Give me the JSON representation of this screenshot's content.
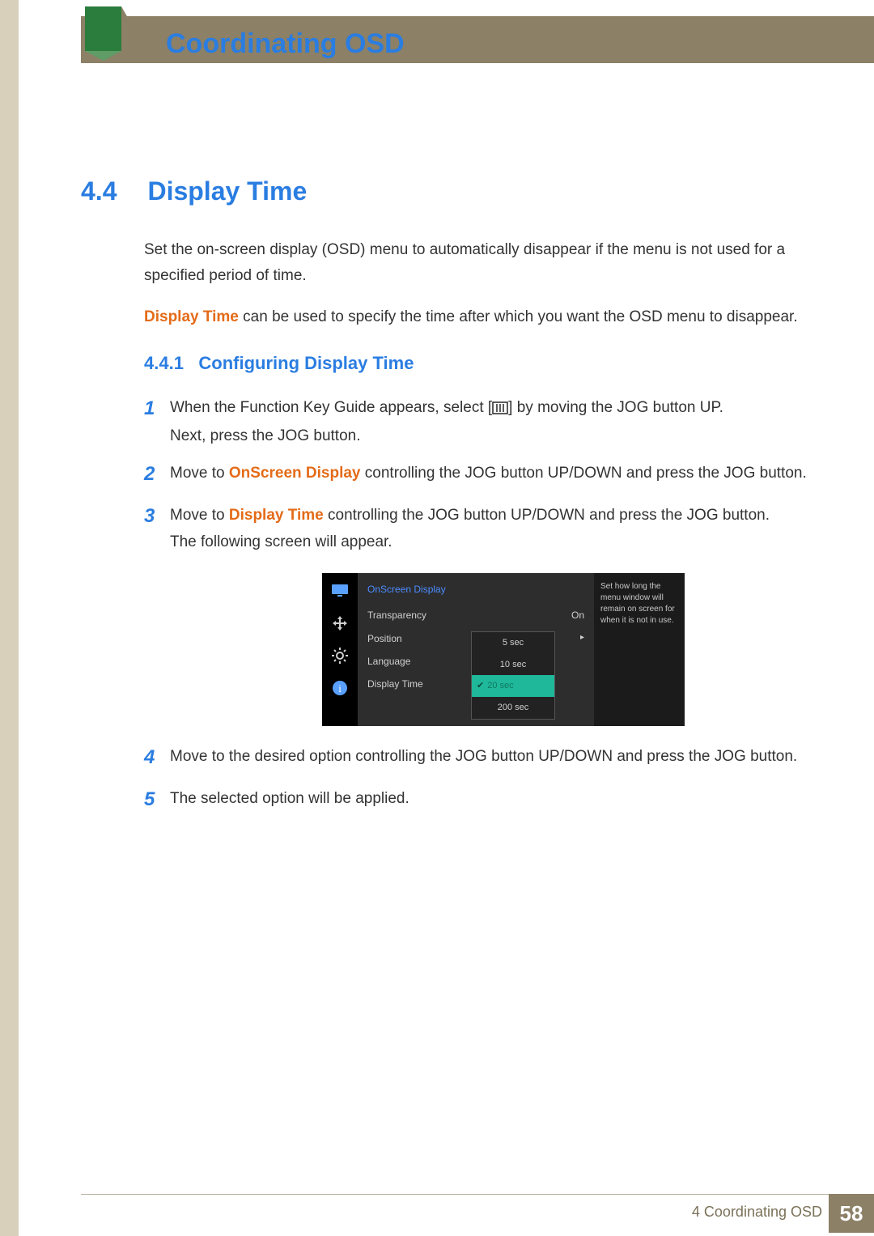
{
  "header": {
    "chapter_number": "4",
    "title": "Coordinating OSD"
  },
  "section": {
    "number": "4.4",
    "title": "Display Time",
    "intro1": "Set the on-screen display (OSD) menu to automatically disappear if the menu is not used for a specified period of time.",
    "intro2_prefix": "Display Time",
    "intro2_rest": " can be used to specify the time after which you want the OSD menu to disappear."
  },
  "subsection": {
    "number": "4.4.1",
    "title": "Configuring Display Time"
  },
  "steps": {
    "s1a": "When the Function Key Guide appears, select [",
    "s1b": "] by moving the JOG button UP.",
    "s1c": "Next, press the JOG button.",
    "s2a": "Move to ",
    "s2_accent": "OnScreen Display",
    "s2b": " controlling the JOG button UP/DOWN and press the JOG button.",
    "s3a": "Move to ",
    "s3_accent": "Display Time",
    "s3b": " controlling the JOG button UP/DOWN and press the JOG button.",
    "s3c": "The following screen will appear.",
    "s4": "Move to the desired option controlling the JOG button UP/DOWN and press the JOG button.",
    "s5": "The selected option will be applied.",
    "n1": "1",
    "n2": "2",
    "n3": "3",
    "n4": "4",
    "n5": "5"
  },
  "osd": {
    "panel_title": "OnScreen Display",
    "items": {
      "transparency": "Transparency",
      "transparency_val": "On",
      "position": "Position",
      "language": "Language",
      "display_time": "Display Time"
    },
    "options": {
      "o1": "5 sec",
      "o2": "10 sec",
      "o3": "20 sec",
      "o4": "200 sec"
    },
    "help": "Set how long the menu window will remain on screen for when it is not in use."
  },
  "footer": {
    "label": "4 Coordinating OSD",
    "page": "58"
  }
}
